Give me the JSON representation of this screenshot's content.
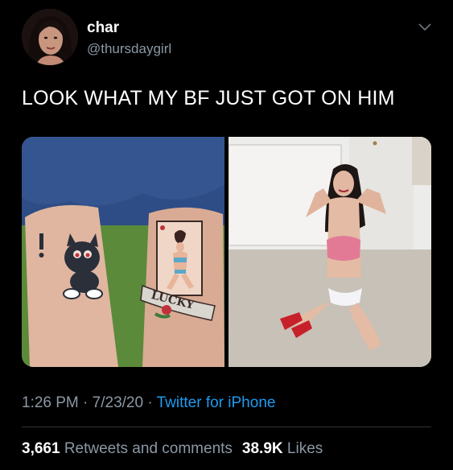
{
  "user": {
    "display_name": "char",
    "handle": "@thursdaygirl"
  },
  "tweet": {
    "text": "LOOK WHAT MY BF JUST GOT ON HIM"
  },
  "media": {
    "left_photo_banner_text": "LUCKY"
  },
  "meta": {
    "time": "1:26 PM",
    "sep1": "·",
    "date": "7/23/20",
    "sep2": "·",
    "source": "Twitter for iPhone"
  },
  "stats": {
    "retweets_count": "3,661",
    "retweets_label": "Retweets and comments",
    "likes_count": "38.9K",
    "likes_label": "Likes"
  },
  "colors": {
    "background": "#000000",
    "secondary_text": "#8b98a5",
    "link": "#1d9bf0",
    "divider": "#2f3336"
  }
}
